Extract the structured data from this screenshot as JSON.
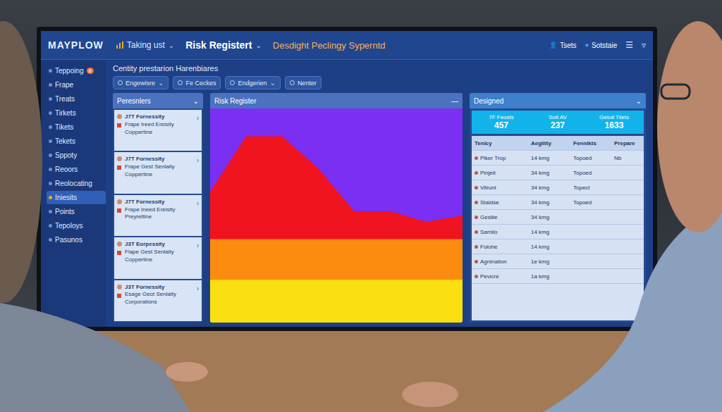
{
  "app": {
    "logo": "MAYPLOW",
    "tabs": [
      {
        "label": "Taking ust",
        "selected": false
      },
      {
        "label": "Risk Registert",
        "selected": true
      },
      {
        "label": "Desdight Peclingy Syperntd",
        "selected": false
      }
    ],
    "header_actions": [
      {
        "label": "Tsets",
        "icon": "👤"
      },
      {
        "label": "Sotstaie",
        "icon": "●"
      }
    ],
    "header_glyphs": [
      "☰",
      "▿"
    ],
    "tab_caret": "⌄",
    "sidebar": {
      "items": [
        {
          "label": "Teppoing",
          "badge": "8",
          "selected": false
        },
        {
          "label": "Frape",
          "selected": false
        },
        {
          "label": "Treats",
          "selected": false
        },
        {
          "label": "Tirkets",
          "selected": false
        },
        {
          "label": "Tikets",
          "selected": false
        },
        {
          "label": "Tekets",
          "selected": false
        },
        {
          "label": "Sppoty",
          "selected": false
        },
        {
          "label": "Reoors",
          "selected": false
        },
        {
          "label": "Reolocating",
          "selected": false
        },
        {
          "label": "Iniesits",
          "selected": true
        },
        {
          "label": "Points",
          "selected": false
        },
        {
          "label": "Tepoloys",
          "selected": false
        },
        {
          "label": "Pasunos",
          "selected": false
        }
      ]
    },
    "page_title": "Centity prestarion Harenbiares",
    "filters": [
      {
        "label": "Engewisre",
        "caret": "⌄"
      },
      {
        "label": "Fe Ceckes",
        "caret": ""
      },
      {
        "label": "Endgerien",
        "caret": "⌄"
      },
      {
        "label": "Nenter",
        "caret": ""
      }
    ],
    "people_panel": {
      "title": "Peresnlers",
      "caret": "⌄",
      "chevron": "›",
      "cards": [
        {
          "title": "J7T Fornessity",
          "line1": "Frape Ireed Ereisity",
          "line2": "Coppertine"
        },
        {
          "title": "J7T Fornessity",
          "line1": "Frape Gest Senlaity",
          "line2": "Coppertine"
        },
        {
          "title": "J7T Fornessity",
          "line1": "Frape Ineed Ereisity",
          "line2": "Preyreltine"
        },
        {
          "title": "J3T Eorpessity",
          "line1": "Fiape Gest Senlaity",
          "line2": "Coppertine"
        },
        {
          "title": "J3T Fornessity",
          "line1": "Esage Geot Senlaity",
          "line2": "Corporations"
        }
      ]
    },
    "chart": {
      "title": "Risk Register",
      "menu": "—",
      "series": [
        {
          "color": "#7a2ff2",
          "values": [
            100,
            100,
            100,
            100,
            100,
            100,
            100,
            100
          ]
        },
        {
          "color": "#f01320",
          "values": [
            61,
            87,
            87,
            72,
            52,
            52,
            47,
            50
          ]
        },
        {
          "color": "#fb8c10",
          "values": [
            39,
            39,
            39,
            39,
            39,
            39,
            39,
            39
          ]
        },
        {
          "color": "#fbe011",
          "values": [
            20,
            20,
            20,
            20,
            20,
            20,
            20,
            20
          ]
        }
      ]
    },
    "summary": {
      "title": "Designed",
      "caret": "⌄",
      "stats": [
        {
          "label": "7F Feosts",
          "value": "457"
        },
        {
          "label": "Sotl AV",
          "value": "237"
        },
        {
          "label": "Getuil Tiiets",
          "value": "1633"
        }
      ]
    },
    "table": {
      "columns": [
        "Tenicy",
        "Aegility",
        "Fennikts",
        "Prepare"
      ],
      "rows": [
        [
          "Piker Trop",
          "14 kmg",
          "Topoed",
          "Nb"
        ],
        [
          "Pinjeit",
          "34 kmg",
          "Topoed",
          ""
        ],
        [
          "Vitrunl",
          "34 kmg",
          "Topect",
          ""
        ],
        [
          "Staidse",
          "34 kmg",
          "Topoed",
          ""
        ],
        [
          "Gesllie",
          "34 kmg",
          "",
          ""
        ],
        [
          "Samilo",
          "14 kmg",
          "",
          ""
        ],
        [
          "Folohe",
          "14 kmg",
          "",
          ""
        ],
        [
          "Agnination",
          "1e kmg",
          "",
          ""
        ],
        [
          "Pevicre",
          "1a kmg",
          "",
          ""
        ]
      ]
    }
  }
}
